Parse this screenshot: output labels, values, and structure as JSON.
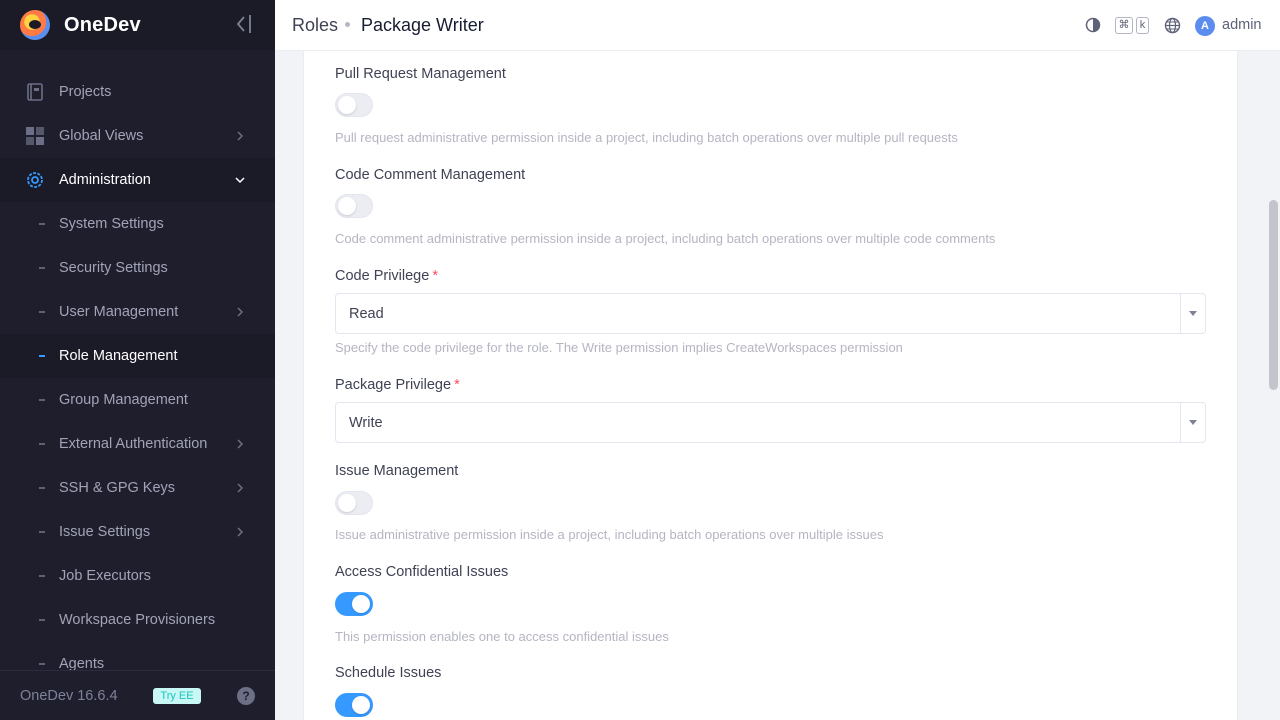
{
  "app": {
    "name": "OneDev",
    "version": "OneDev 16.6.4",
    "try_ee": "Try EE",
    "help": "?"
  },
  "sidebar": {
    "items": [
      {
        "label": "Projects",
        "icon": "projects-icon"
      },
      {
        "label": "Global Views",
        "icon": "grid-icon",
        "has_children": true
      },
      {
        "label": "Administration",
        "icon": "gear-icon",
        "expanded": true
      }
    ],
    "sub_items": [
      {
        "label": "System Settings"
      },
      {
        "label": "Security Settings"
      },
      {
        "label": "User Management",
        "has_children": true
      },
      {
        "label": "Role Management",
        "current": true
      },
      {
        "label": "Group Management"
      },
      {
        "label": "External Authentication",
        "has_children": true
      },
      {
        "label": "SSH & GPG Keys",
        "has_children": true
      },
      {
        "label": "Issue Settings",
        "has_children": true
      },
      {
        "label": "Job Executors"
      },
      {
        "label": "Workspace Provisioners"
      },
      {
        "label": "Agents"
      }
    ]
  },
  "header": {
    "breadcrumb_parent": "Roles",
    "title": "Package Writer",
    "kbd_cmd": "⌘",
    "kbd_k": "k",
    "avatar_letter": "A",
    "user": "admin"
  },
  "form": {
    "pull_request": {
      "label": "Pull Request Management",
      "enabled": false,
      "help": "Pull request administrative permission inside a project, including batch operations over multiple pull requests"
    },
    "code_comment": {
      "label": "Code Comment Management",
      "enabled": false,
      "help": "Code comment administrative permission inside a project, including batch operations over multiple code comments"
    },
    "code_privilege": {
      "label": "Code Privilege",
      "required": "*",
      "value": "Read",
      "help": "Specify the code privilege for the role. The Write permission implies CreateWorkspaces permission"
    },
    "package_privilege": {
      "label": "Package Privilege",
      "required": "*",
      "value": "Write"
    },
    "issue_management": {
      "label": "Issue Management",
      "enabled": false,
      "help": "Issue administrative permission inside a project, including batch operations over multiple issues"
    },
    "confidential_issues": {
      "label": "Access Confidential Issues",
      "enabled": true,
      "help": "This permission enables one to access confidential issues"
    },
    "schedule_issues": {
      "label": "Schedule Issues",
      "enabled": true
    }
  },
  "colors": {
    "accent": "#3699ff",
    "sidebar_bg": "#1e1e2d",
    "required": "#f64e60"
  }
}
